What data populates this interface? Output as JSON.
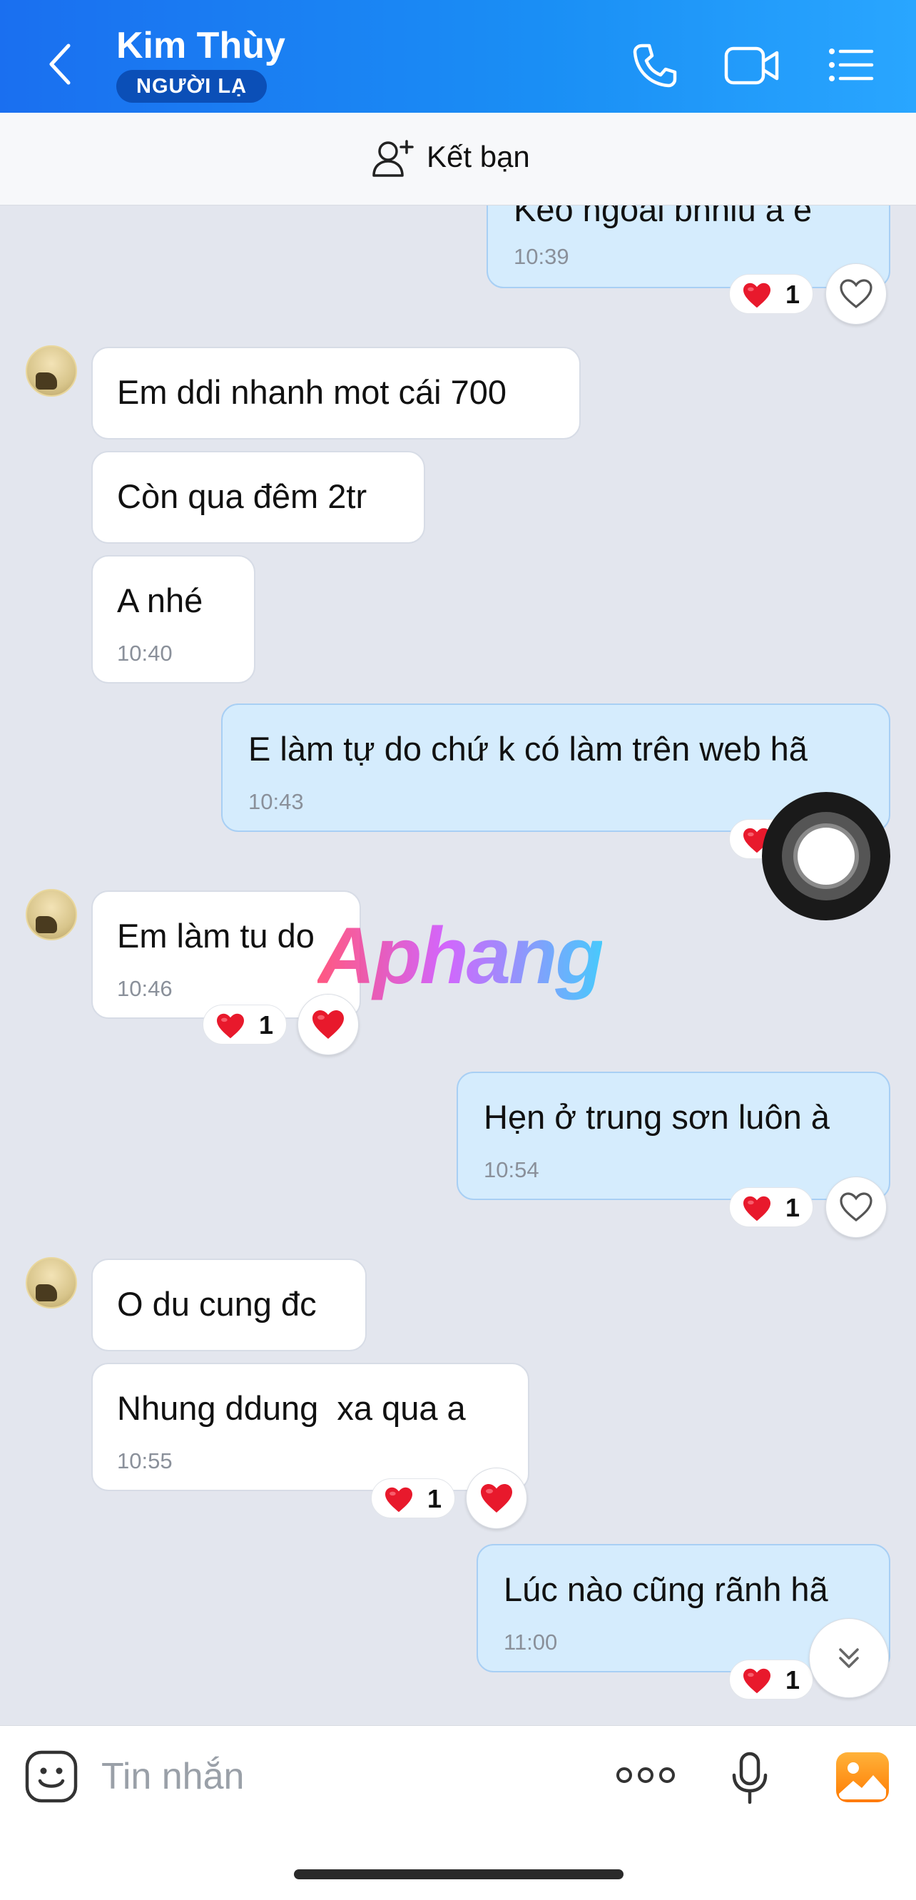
{
  "header": {
    "title": "Kim Thùy",
    "badge": "NGƯỜI LẠ",
    "icons": [
      "back-icon",
      "phone-icon",
      "video-call-icon",
      "menu-list-icon"
    ]
  },
  "friend_bar": {
    "label": "Kết bạn",
    "icon": "add-friend-icon"
  },
  "messages": [
    {
      "dir": "out",
      "text": "Kèo ngoài bnhiu a e",
      "time": "10:39",
      "reaction_count": "1"
    },
    {
      "dir": "in",
      "text": "Em ddi nhanh mot cái 700"
    },
    {
      "dir": "in",
      "text": "Còn qua đêm 2tr"
    },
    {
      "dir": "in",
      "text": "A nhé",
      "time": "10:40"
    },
    {
      "dir": "out",
      "text": "E làm tự do chứ k có làm trên web hã",
      "time": "10:43"
    },
    {
      "dir": "in",
      "text": "Em làm tu do",
      "time": "10:46",
      "reaction_count": "1"
    },
    {
      "dir": "out",
      "text": "Hẹn ở trung sơn luôn à",
      "time": "10:54",
      "reaction_count": "1"
    },
    {
      "dir": "in",
      "text": "O du cung đc"
    },
    {
      "dir": "in",
      "text": "Nhung ddung  xa qua a",
      "time": "10:55",
      "reaction_count": "1"
    },
    {
      "dir": "out",
      "text": "Lúc nào cũng rãnh hã",
      "time": "11:00",
      "reaction_count": "1"
    }
  ],
  "watermark": "Aphang",
  "composer": {
    "placeholder": "Tin nhắn",
    "icons": [
      "emoji-icon",
      "more-options-icon",
      "microphone-icon",
      "image-gallery-icon"
    ]
  },
  "colors": {
    "header_start": "#1a6ff0",
    "header_end": "#29a6ff",
    "outgoing_bubble": "#d5ecfd",
    "incoming_bubble": "#ffffff",
    "chat_background": "#e3e6ee",
    "heart": "#e8192c"
  }
}
